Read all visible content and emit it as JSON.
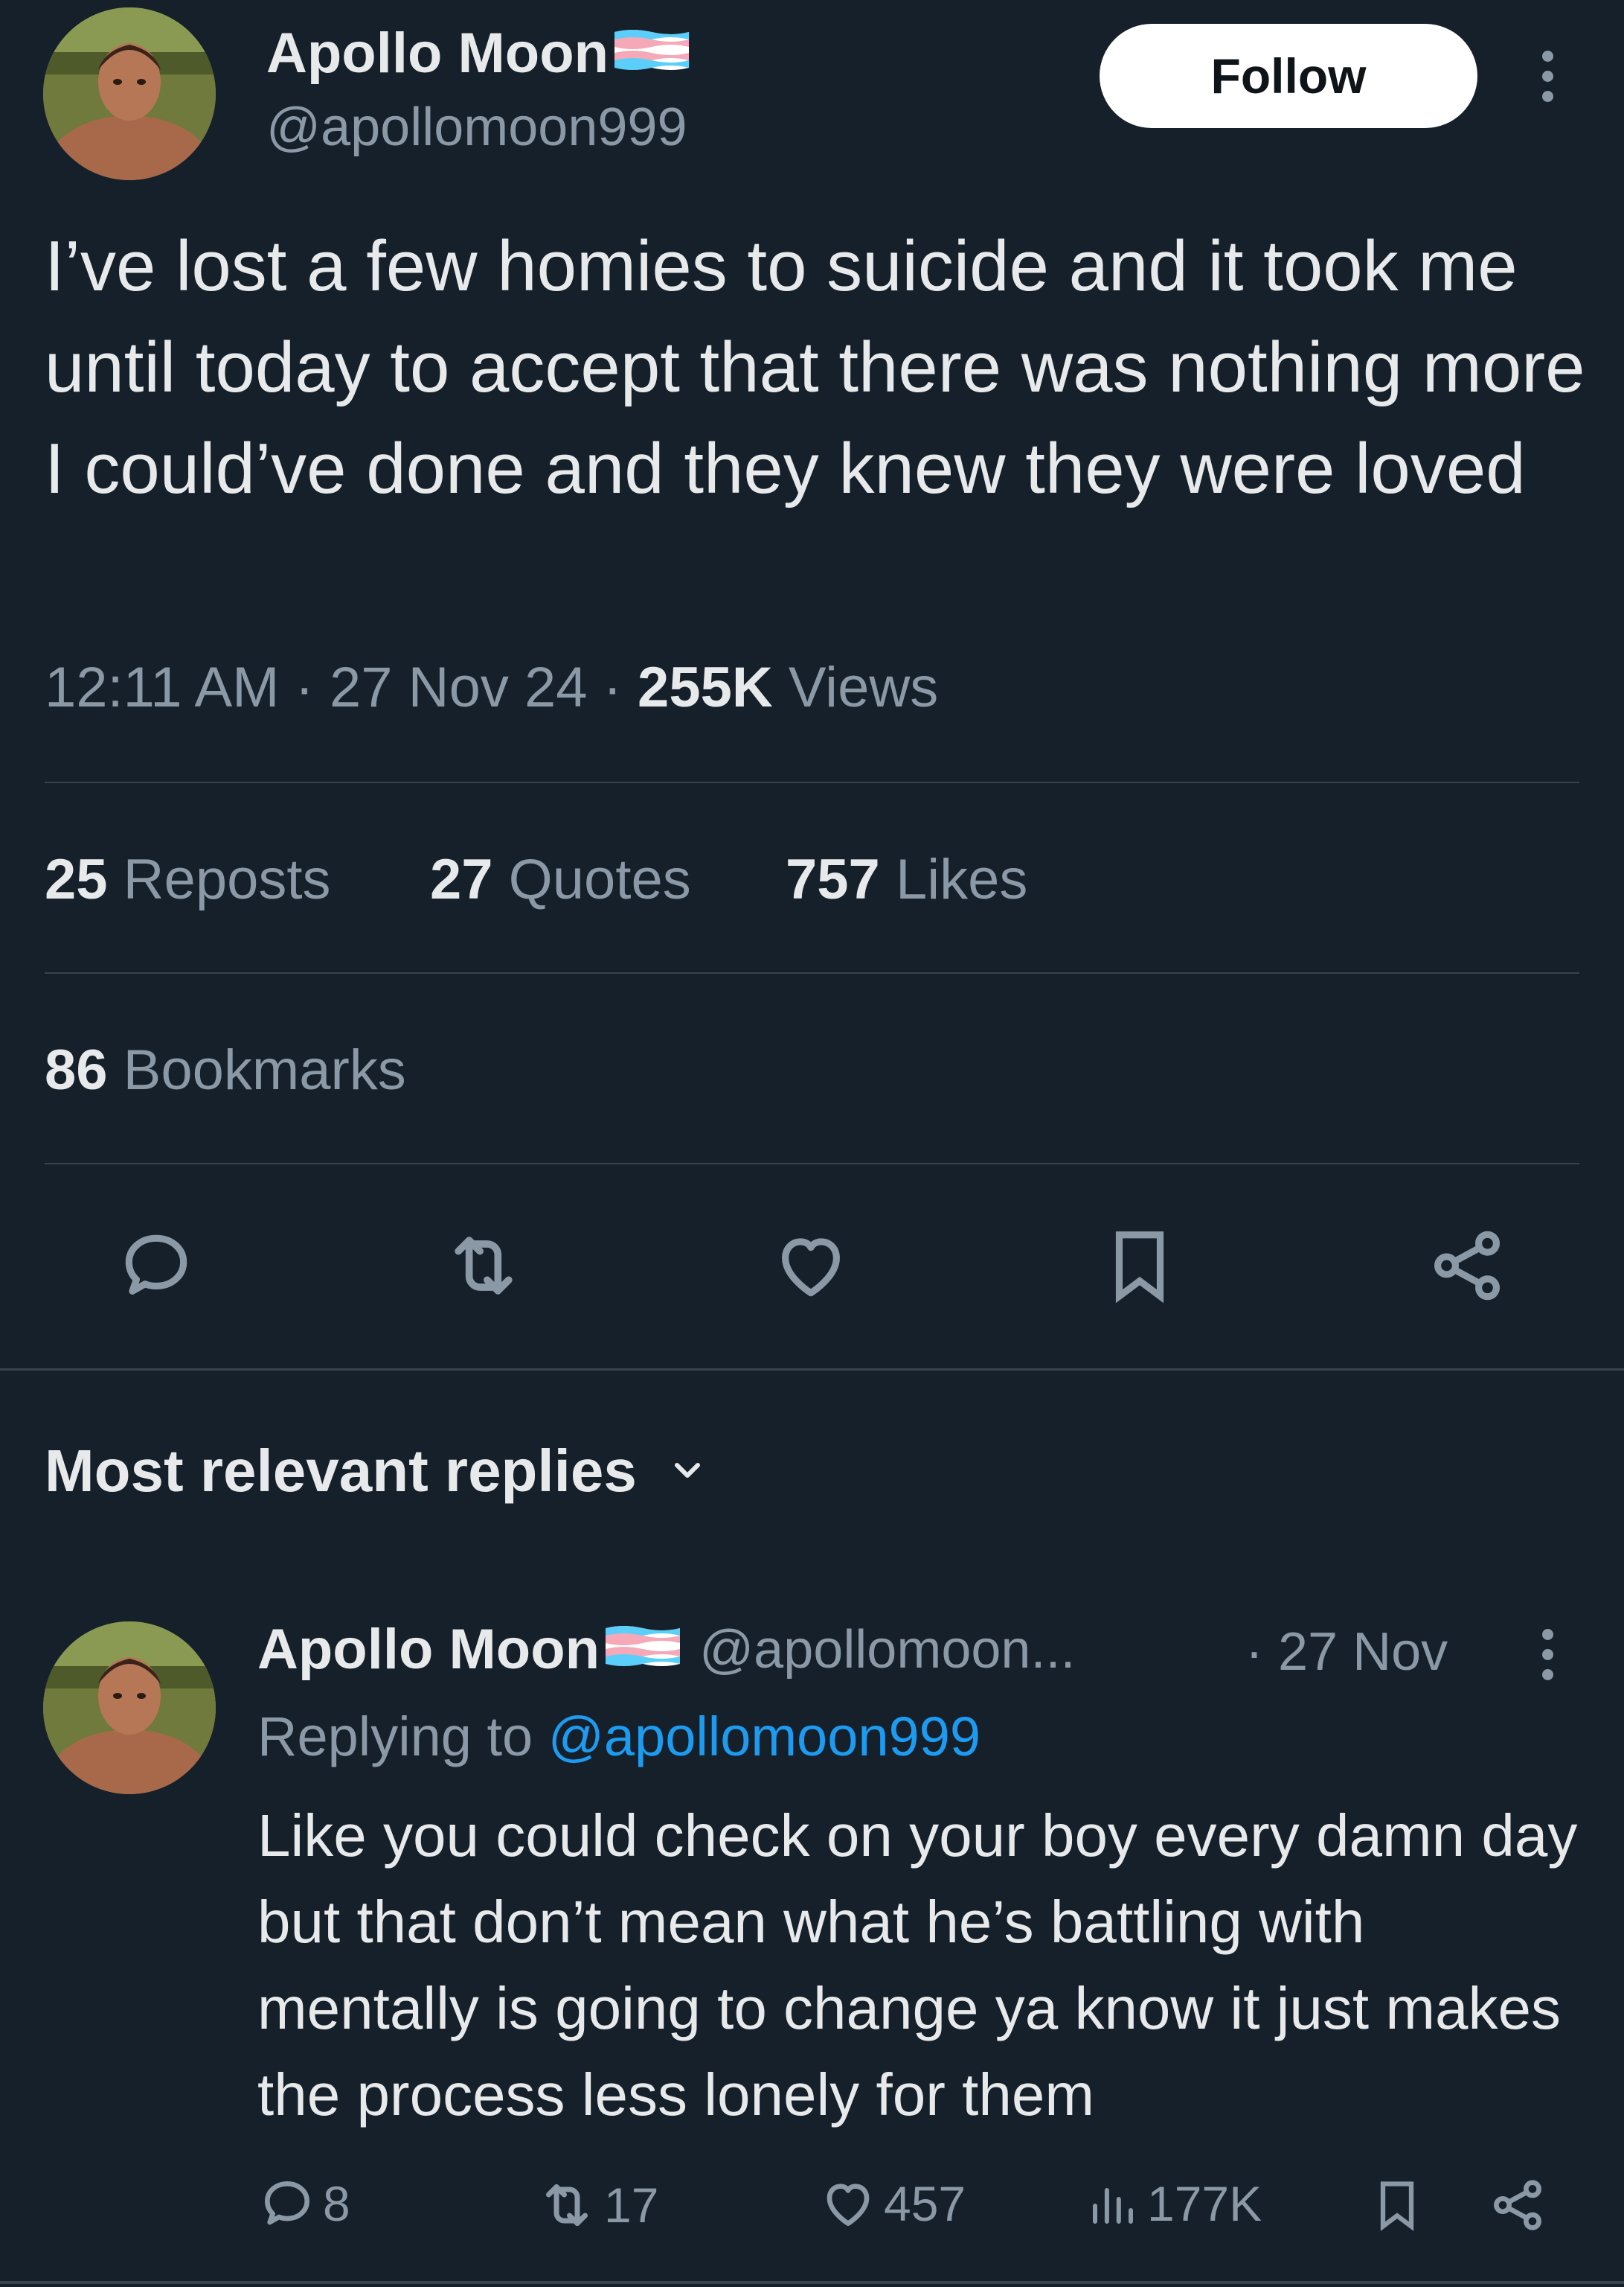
{
  "tweet": {
    "author_name": "Apollo Moon",
    "author_handle": "@apollomoon999",
    "follow_label": "Follow",
    "text": "I’ve lost a few homies to suicide and it took me until today to accept that there was nothing more I could’ve done and they knew they were loved",
    "time": "12:11 AM",
    "date": "27 Nov 24",
    "views_count": "255K",
    "views_label": "Views",
    "reposts_count": "25",
    "reposts_label": "Reposts",
    "quotes_count": "27",
    "quotes_label": "Quotes",
    "likes_count": "757",
    "likes_label": "Likes",
    "bookmarks_count": "86",
    "bookmarks_label": "Bookmarks",
    "actions": [
      "reply-icon",
      "repost-icon",
      "like-icon",
      "bookmark-icon",
      "share-icon"
    ]
  },
  "replies_section": {
    "title": "Most relevant replies"
  },
  "reply": {
    "author_name": "Apollo Moon",
    "author_handle": "@apollomoon...",
    "date": "· 27 Nov",
    "replying_label": "Replying to",
    "replying_handle": "@apollomoon999",
    "text": "Like you could check on your boy every damn day but that don’t mean what he’s battling with mentally is going to change ya know it just makes the process less lonely for them",
    "reply_count": "8",
    "repost_count": "17",
    "like_count": "457",
    "view_count": "177K"
  },
  "colors": {
    "background": "#15202b",
    "text_primary": "#e7e9ea",
    "text_secondary": "#8b98a5",
    "divider": "#38444d",
    "link": "#1d9bf0",
    "flag_blue": "#5bcefa",
    "flag_pink": "#f5a9b8"
  }
}
